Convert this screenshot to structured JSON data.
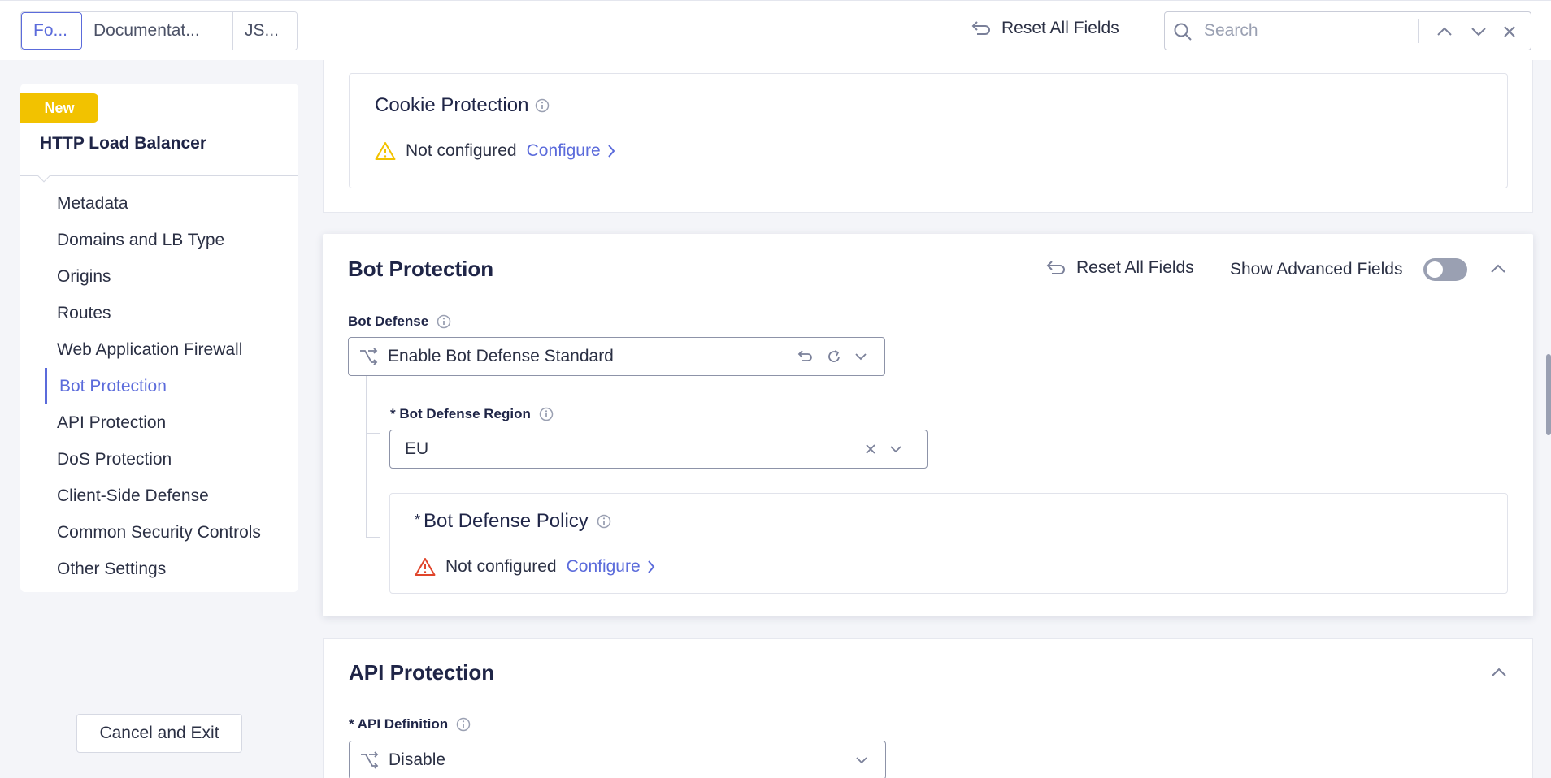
{
  "header": {
    "tabs": [
      {
        "label": "Fo..."
      },
      {
        "label": "Documentat..."
      },
      {
        "label": "JS..."
      }
    ],
    "reset_label": "Reset All Fields",
    "search_placeholder": "Search"
  },
  "sidebar": {
    "badge": "New",
    "title": "HTTP Load Balancer",
    "items": [
      {
        "label": "Metadata"
      },
      {
        "label": "Domains and LB Type"
      },
      {
        "label": "Origins"
      },
      {
        "label": "Routes"
      },
      {
        "label": "Web Application Firewall"
      },
      {
        "label": "Bot Protection"
      },
      {
        "label": "API Protection"
      },
      {
        "label": "DoS Protection"
      },
      {
        "label": "Client-Side Defense"
      },
      {
        "label": "Common Security Controls"
      },
      {
        "label": "Other Settings"
      }
    ],
    "active_item": "Bot Protection",
    "cancel_label": "Cancel and Exit"
  },
  "cookie_protection": {
    "title": "Cookie Protection",
    "status": "Not configured",
    "configure_label": "Configure"
  },
  "bot_protection": {
    "title": "Bot Protection",
    "reset_label": "Reset All Fields",
    "advanced_label": "Show Advanced Fields",
    "advanced_enabled": false,
    "bot_defense": {
      "label": "Bot Defense",
      "value": "Enable Bot Defense Standard"
    },
    "region": {
      "label": "* Bot Defense Region",
      "value": "EU"
    },
    "policy": {
      "required_mark": "*",
      "title": "Bot Defense Policy",
      "status": "Not configured",
      "configure_label": "Configure"
    }
  },
  "api_protection": {
    "title": "API Protection",
    "api_definition": {
      "label": "* API Definition",
      "value": "Disable"
    }
  },
  "colors": {
    "accent": "#5b6bdb",
    "badge": "#f2c200",
    "warning": "#f2c200",
    "error": "#e0452b",
    "text": "#1f2547"
  }
}
